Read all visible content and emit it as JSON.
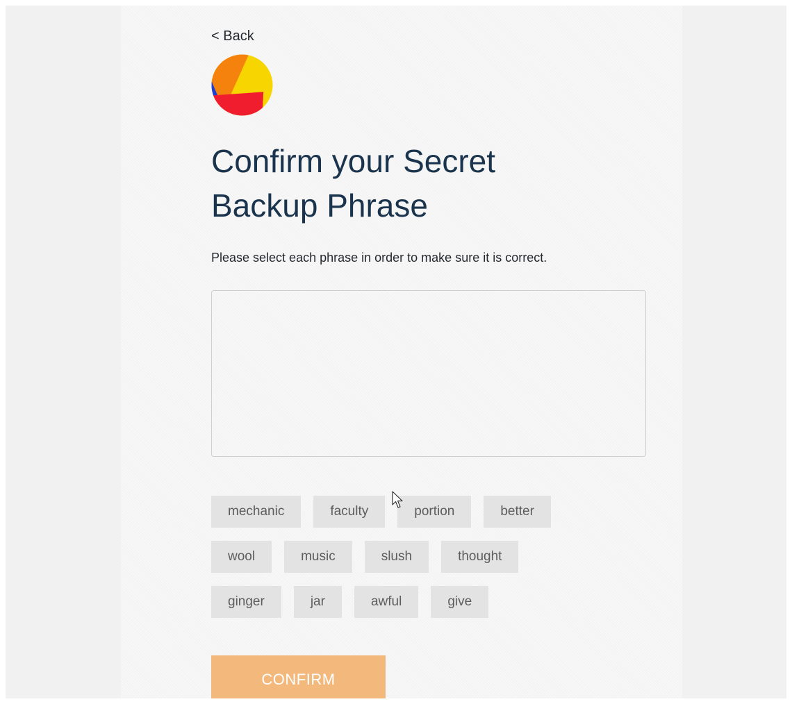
{
  "header": {
    "back_label": "< Back",
    "avatar_icon": "identicon-avatar"
  },
  "main": {
    "title": "Confirm your Secret Backup Phrase",
    "subtitle": "Please select each phrase in order to make sure it is correct.",
    "selected_phrase": ""
  },
  "word_rows": [
    [
      "mechanic",
      "faculty",
      "portion",
      "better"
    ],
    [
      "wool",
      "music",
      "slush",
      "thought"
    ],
    [
      "ginger",
      "jar",
      "awful",
      "give"
    ]
  ],
  "confirm_button": {
    "label": "CONFIRM",
    "enabled": false,
    "color": "#f3b87b"
  },
  "colors": {
    "title": "#1b344d",
    "word_button_bg": "#e3e3e3",
    "avatar_colors": [
      "#f7d500",
      "#f5820d",
      "#ef1d2d",
      "#1f3fd4"
    ]
  }
}
